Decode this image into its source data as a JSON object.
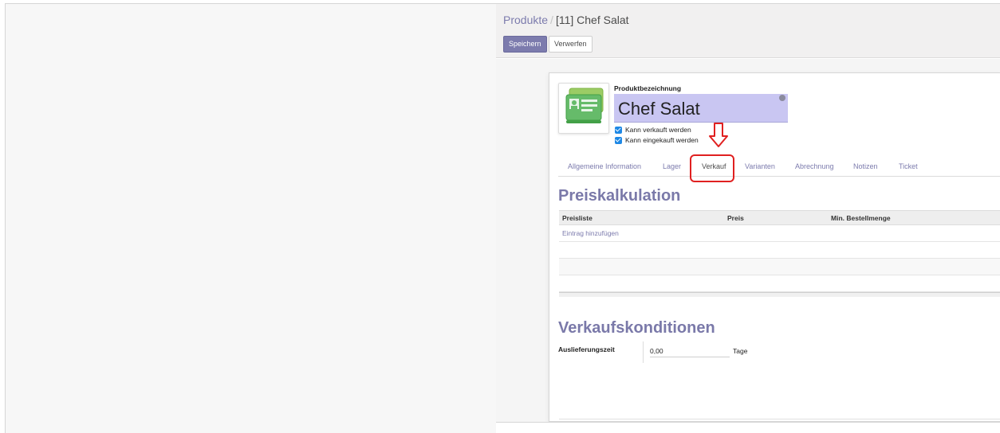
{
  "breadcrumb": {
    "parent": "Produkte",
    "separator": "/",
    "current": "[11] Chef Salat"
  },
  "buttons": {
    "save": "Speichern",
    "discard": "Verwerfen"
  },
  "product": {
    "name_label": "Produktbezeichnung",
    "name": "Chef Salat",
    "can_be_sold": "Kann verkauft werden",
    "can_be_purchased": "Kann eingekauft werden"
  },
  "tabs": [
    "Allgemeine Information",
    "Lager",
    "Verkauf",
    "Varianten",
    "Abrechnung",
    "Notizen",
    "Ticket"
  ],
  "active_tab": "Verkauf",
  "pricing": {
    "title": "Preiskalkulation",
    "columns": [
      "Preisliste",
      "Preis",
      "Min. Bestellmenge"
    ],
    "add_line": "Eintrag hinzufügen"
  },
  "sales_conditions": {
    "title": "Verkaufskonditionen",
    "lead_time_label": "Auslieferungszeit",
    "lead_time_value": "0,00",
    "lead_time_unit": "Tage"
  },
  "colors": {
    "accent": "#7c7bad",
    "highlight": "#e02020",
    "name_field": "#c9c6f2"
  }
}
